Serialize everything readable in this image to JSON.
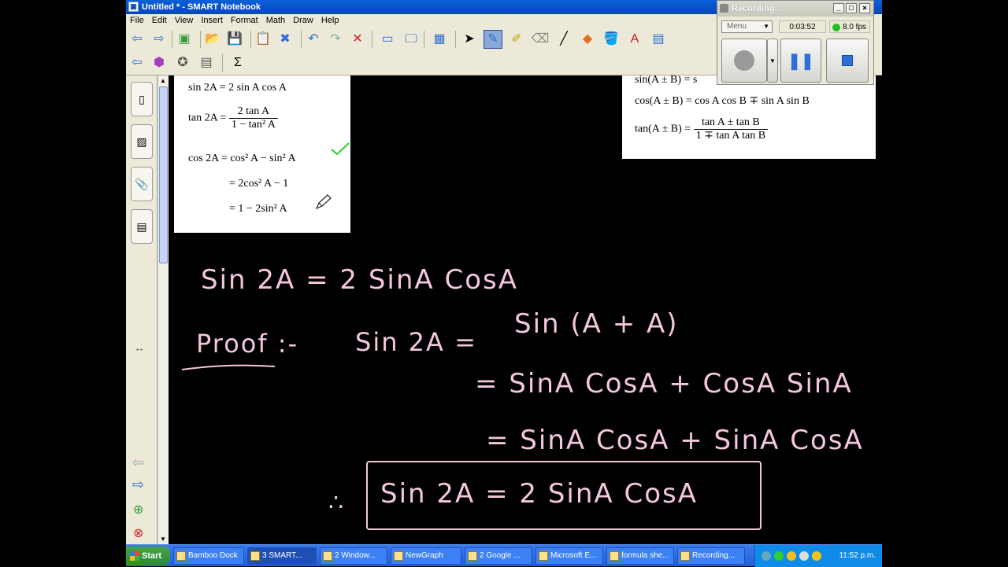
{
  "window": {
    "title": "Untitled * - SMART Notebook"
  },
  "menu": [
    "File",
    "Edit",
    "View",
    "Insert",
    "Format",
    "Math",
    "Draw",
    "Help"
  ],
  "toolbar": {
    "row1": [
      {
        "name": "back-arrow-icon",
        "glyph": "⇦",
        "color": "#2d6fd6"
      },
      {
        "name": "forward-arrow-icon",
        "glyph": "⇨",
        "color": "#2d6fd6"
      },
      {
        "name": "add-page-icon",
        "glyph": "▣",
        "color": "#3a9a3a"
      },
      {
        "name": "open-folder-icon",
        "glyph": "📂",
        "color": "#d8a020"
      },
      {
        "name": "save-icon",
        "glyph": "💾",
        "color": "#2d6fd6"
      },
      {
        "name": "paste-icon",
        "glyph": "📋",
        "color": "#666"
      },
      {
        "name": "delete-page-icon",
        "glyph": "✖",
        "color": "#2d6fd6"
      },
      {
        "name": "undo-icon",
        "glyph": "↶",
        "color": "#2d6fd6"
      },
      {
        "name": "redo-icon",
        "glyph": "↷",
        "color": "#8aa"
      },
      {
        "name": "delete-icon",
        "glyph": "✕",
        "color": "#d02020"
      },
      {
        "name": "screen-shade-icon",
        "glyph": "▭",
        "color": "#2d6fd6"
      },
      {
        "name": "full-screen-icon",
        "glyph": "🖵",
        "color": "#2d6fd6"
      },
      {
        "name": "table-icon",
        "glyph": "▦",
        "color": "#2d6fd6"
      },
      {
        "name": "select-arrow-icon",
        "glyph": "➤",
        "color": "#000"
      },
      {
        "name": "pen-icon",
        "glyph": "✎",
        "color": "#2d6fd6"
      },
      {
        "name": "creative-pen-icon",
        "glyph": "✐",
        "color": "#c0a020"
      },
      {
        "name": "eraser-icon",
        "glyph": "⌫",
        "color": "#888"
      },
      {
        "name": "line-icon",
        "glyph": "╱",
        "color": "#000"
      },
      {
        "name": "shapes-icon",
        "glyph": "◆",
        "color": "#e07020"
      },
      {
        "name": "fill-icon",
        "glyph": "🪣",
        "color": "#555"
      },
      {
        "name": "text-icon",
        "glyph": "A",
        "color": "#c02020"
      },
      {
        "name": "properties-icon",
        "glyph": "▤",
        "color": "#2d6fd6"
      }
    ],
    "row2": [
      {
        "name": "move-toolbar-icon",
        "glyph": "⇦",
        "color": "#2d6fd6"
      },
      {
        "name": "magic-pen-icon",
        "glyph": "⬢",
        "color": "#a040c0"
      },
      {
        "name": "shape-recognition-icon",
        "glyph": "✪",
        "color": "#555"
      },
      {
        "name": "handwriting-icon",
        "glyph": "▤",
        "color": "#555"
      },
      {
        "name": "sigma-icon",
        "glyph": "Σ",
        "color": "#000"
      }
    ]
  },
  "sidetabs": [
    {
      "name": "page-sorter-tab-icon",
      "glyph": "▯"
    },
    {
      "name": "gallery-tab-icon",
      "glyph": "▨"
    },
    {
      "name": "attachments-tab-icon",
      "glyph": "📎"
    },
    {
      "name": "properties-tab-icon",
      "glyph": "▤"
    }
  ],
  "sidebottom": [
    {
      "name": "side-back-arrow-icon",
      "glyph": "⇦",
      "color": "#9ab"
    },
    {
      "name": "side-forward-arrow-icon",
      "glyph": "⇨",
      "color": "#2d6fd6"
    },
    {
      "name": "side-add-page-icon",
      "glyph": "⊕",
      "color": "#2a9a2a"
    },
    {
      "name": "side-delete-page-icon",
      "glyph": "⊗",
      "color": "#d02020"
    }
  ],
  "resize_glyph": "↔",
  "formulas_left": {
    "l1": {
      "lhs": "sin 2A = 2 sin A cos A"
    },
    "l2": {
      "lhs": "tan 2A =",
      "num": "2 tan A",
      "den": "1 − tan² A"
    },
    "l3": {
      "lhs": "cos 2A = cos² A − sin² A"
    },
    "l4": {
      "lhs": "= 2cos² A − 1"
    },
    "l5": {
      "lhs": "= 1 − 2sin² A"
    }
  },
  "formulas_right": {
    "l1": {
      "lhs": "sin(A ± B) = s"
    },
    "l2": {
      "lhs": "cos(A ± B) = cos A cos B ∓ sin A sin B"
    },
    "l3": {
      "lhs": "tan(A ± B) =",
      "num": "tan A ± tan B",
      "den": "1 ∓ tan A tan B"
    }
  },
  "handwriting": {
    "line1": "Sin 2A  =  2 SinA CosA",
    "proof": "Proof :-",
    "line2_lhs": "Sin 2A  =",
    "line2_rhs": "Sin (A + A)",
    "line3": "= SinA CosA  + CosA SinA",
    "line4": "= SinA CosA + SinA CosA",
    "therefore": "∴",
    "boxed": "Sin 2A  =  2 SinA CosA"
  },
  "recorder": {
    "title": "Recording...",
    "menu_label": "Menu",
    "elapsed": "0:03:52",
    "fps": "8.0 fps"
  },
  "taskbar": {
    "start": "Start",
    "tasks": [
      {
        "label": "Bamboo Dock",
        "w": 90
      },
      {
        "label": "3 SMART...",
        "w": 88,
        "active": true
      },
      {
        "label": "2 Window...",
        "w": 86
      },
      {
        "label": "NewGraph",
        "w": 90
      },
      {
        "label": "2 Google ...",
        "w": 86
      },
      {
        "label": "Microsoft E...",
        "w": 86
      },
      {
        "label": "formula she...",
        "w": 86
      },
      {
        "label": "Recording...",
        "w": 86
      }
    ],
    "clock": "11:52 p.m."
  },
  "colors": {
    "ink": "#f3c6df",
    "check": "#2fcf2f",
    "accent": "#0747b8"
  }
}
